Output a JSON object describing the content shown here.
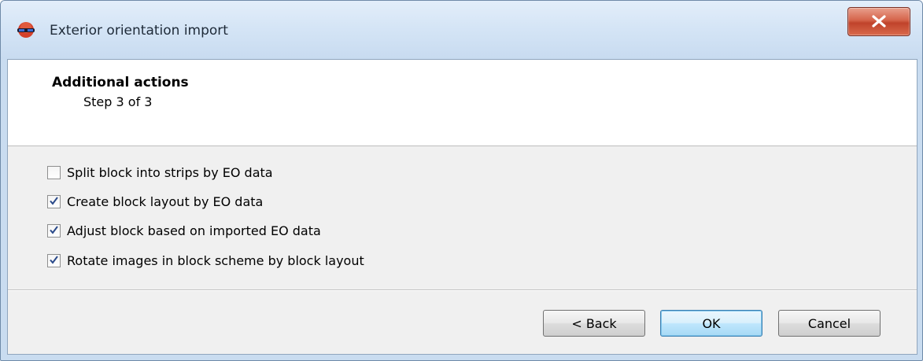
{
  "window": {
    "title": "Exterior orientation import"
  },
  "icons": {
    "app": "stereo-glasses-icon",
    "close": "close-icon"
  },
  "header": {
    "title": "Additional actions",
    "step": "Step 3 of 3"
  },
  "options": [
    {
      "label": "Split block into strips by EO data",
      "checked": false
    },
    {
      "label": "Create block layout by EO data",
      "checked": true
    },
    {
      "label": "Adjust block based on imported EO data",
      "checked": true
    },
    {
      "label": "Rotate images in block scheme by block layout",
      "checked": true
    }
  ],
  "buttons": {
    "back": "< Back",
    "ok": "OK",
    "cancel": "Cancel"
  },
  "colors": {
    "title_bar": "#d5e5f6",
    "close_button": "#c7472e",
    "default_button": "#bee6fd",
    "dialog_bg": "#f0f0f0"
  }
}
